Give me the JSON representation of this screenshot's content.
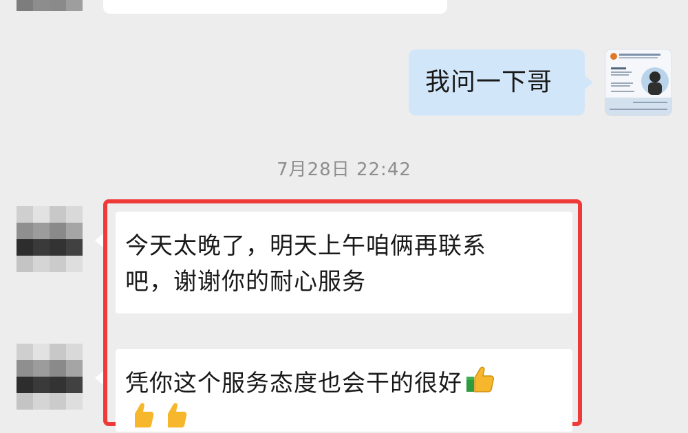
{
  "chat": {
    "messages": {
      "outgoing_1": "我问一下哥",
      "timestamp": "7月28日 22:42",
      "incoming_1": "今天太晚了，明天上午咱俩再联系吧，谢谢你的耐心服务",
      "incoming_1_line1": "今天太晚了，明天上午咱俩再联系",
      "incoming_1_line2": "吧，谢谢你的耐心服务",
      "incoming_2": "凭你这个服务态度也会干的很好"
    },
    "icons": {
      "emoji": "thumbs-up-icon"
    },
    "colors": {
      "background": "#ededed",
      "incoming_bubble": "#ffffff",
      "outgoing_bubble": "#d2e6f9",
      "highlight_border": "#ef3a3a",
      "timestamp_text": "#8e8e8e"
    }
  }
}
